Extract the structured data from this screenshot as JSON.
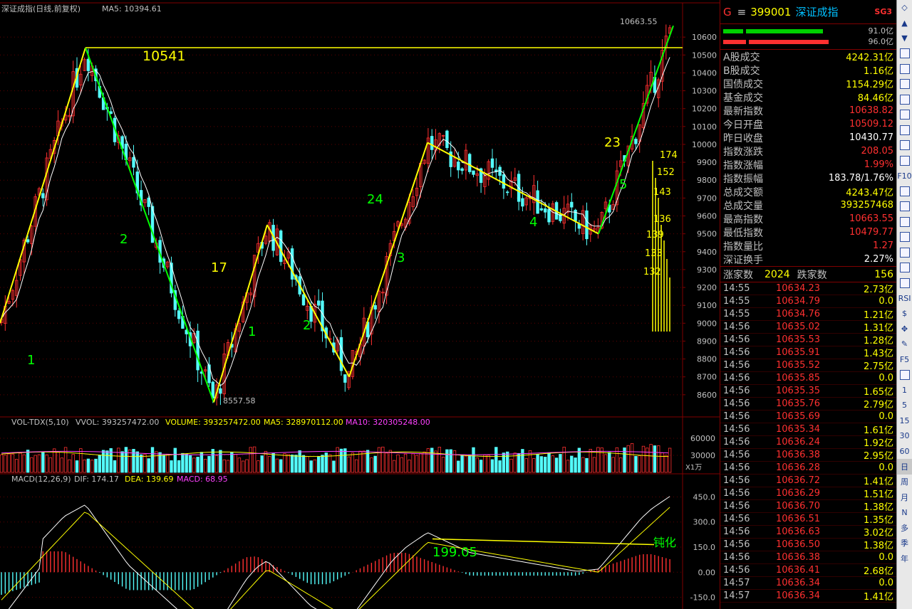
{
  "main_chart": {
    "title": "深证成指(日线,前复权)",
    "ma_label": "MA5: 10394.61",
    "high_label": "10663.55",
    "low_label": "8557.58",
    "y_ticks": [
      "10600",
      "10500",
      "10400",
      "10300",
      "10200",
      "10100",
      "10000",
      "9900",
      "9800",
      "9700",
      "9600",
      "9500",
      "9400",
      "9300",
      "9200",
      "9100",
      "9000",
      "8900",
      "8800",
      "8700",
      "8600"
    ],
    "annotations": {
      "peak": "10541",
      "w1": "1",
      "w2": "2",
      "w17": "17",
      "w1b": "1",
      "w2b": "2",
      "w24": "24",
      "w3": "3",
      "w4": "4",
      "w23": "23",
      "w5": "5",
      "stack": [
        "174",
        "152",
        "143",
        "136",
        "139",
        "133",
        "132"
      ]
    }
  },
  "vol_panel": {
    "label": "VOL-TDX(5,10)",
    "vvol": "VVOL: 393257472.00",
    "volume": "VOLUME: 393257472.00",
    "ma5": "MA5: 328970112.00",
    "ma10": "MA10: 320305248.00",
    "y_ticks": [
      "60000",
      "30000"
    ],
    "unit": "X1万"
  },
  "macd_panel": {
    "label": "MACD(12,26,9)",
    "dif": "DIF: 174.17",
    "dea": "DEA: 139.69",
    "macd": "MACD: 68.95",
    "y_ticks": [
      "450.0",
      "300.0",
      "150.0",
      "0.00",
      "-150.0"
    ],
    "note_value": "199.05",
    "note_text": "钝化"
  },
  "chart_data": {
    "type": "candlestick",
    "title": "深证成指(日线,前复权)",
    "ylim": [
      8480,
      10720
    ],
    "price_path": [
      [
        0,
        9000
      ],
      [
        120,
        10541
      ],
      [
        300,
        8557.58
      ],
      [
        375,
        9550
      ],
      [
        490,
        8700
      ],
      [
        600,
        10010
      ],
      [
        840,
        9500
      ],
      [
        945,
        10663.55
      ]
    ],
    "swing_points": [
      {
        "x": 0,
        "y": 9000
      },
      {
        "x": 120,
        "y": 10541
      },
      {
        "x": 300,
        "y": 8557.58
      },
      {
        "x": 375,
        "y": 9550
      },
      {
        "x": 490,
        "y": 8700
      },
      {
        "x": 600,
        "y": 10010
      },
      {
        "x": 840,
        "y": 9500
      },
      {
        "x": 945,
        "y": 10663.55
      }
    ],
    "vol_ylim": [
      0,
      75000
    ],
    "macd_ylim": [
      -220,
      520
    ]
  },
  "right_panel": {
    "header": {
      "badge": "G",
      "menu": "≡",
      "code": "399001",
      "name": "深证成指",
      "tag": "SG3"
    },
    "bars": {
      "top_value": "91.0亿",
      "bottom_value": "96.0亿"
    },
    "stats": [
      {
        "label": "A股成交",
        "value": "4242.31亿",
        "color": "c-y"
      },
      {
        "label": "B股成交",
        "value": "1.16亿",
        "color": "c-y"
      },
      {
        "label": "国债成交",
        "value": "1154.29亿",
        "color": "c-y"
      },
      {
        "label": "基金成交",
        "value": "84.46亿",
        "color": "c-y"
      },
      {
        "label": "最新指数",
        "value": "10638.82",
        "color": "c-r"
      },
      {
        "label": "今日开盘",
        "value": "10509.12",
        "color": "c-r"
      },
      {
        "label": "昨日收盘",
        "value": "10430.77",
        "color": "c-w"
      },
      {
        "label": "指数涨跌",
        "value": "208.05",
        "color": "c-r"
      },
      {
        "label": "指数涨幅",
        "value": "1.99%",
        "color": "c-r"
      },
      {
        "label": "指数振幅",
        "value": "183.78/1.76%",
        "color": "c-w"
      },
      {
        "label": "总成交额",
        "value": "4243.47亿",
        "color": "c-y"
      },
      {
        "label": "总成交量",
        "value": "393257468",
        "color": "c-y"
      },
      {
        "label": "最高指数",
        "value": "10663.55",
        "color": "c-r"
      },
      {
        "label": "最低指数",
        "value": "10479.77",
        "color": "c-r"
      },
      {
        "label": "指数量比",
        "value": "1.27",
        "color": "c-r"
      },
      {
        "label": "深证换手",
        "value": "2.27%",
        "color": "c-w"
      }
    ],
    "updown": {
      "up_label": "涨家数",
      "up_value": "2024",
      "down_label": "跌家数",
      "down_value": "156"
    },
    "ticks": [
      {
        "time": "14:55",
        "price": "10634.23",
        "vol": "2.73亿"
      },
      {
        "time": "14:55",
        "price": "10634.79",
        "vol": "0.0"
      },
      {
        "time": "14:55",
        "price": "10634.76",
        "vol": "1.21亿"
      },
      {
        "time": "14:56",
        "price": "10635.02",
        "vol": "1.31亿"
      },
      {
        "time": "14:56",
        "price": "10635.53",
        "vol": "1.28亿"
      },
      {
        "time": "14:56",
        "price": "10635.91",
        "vol": "1.43亿"
      },
      {
        "time": "14:56",
        "price": "10635.52",
        "vol": "2.75亿"
      },
      {
        "time": "14:56",
        "price": "10635.85",
        "vol": "0.0"
      },
      {
        "time": "14:56",
        "price": "10635.35",
        "vol": "1.65亿"
      },
      {
        "time": "14:56",
        "price": "10635.76",
        "vol": "2.79亿"
      },
      {
        "time": "14:56",
        "price": "10635.69",
        "vol": "0.0"
      },
      {
        "time": "14:56",
        "price": "10635.34",
        "vol": "1.61亿"
      },
      {
        "time": "14:56",
        "price": "10636.24",
        "vol": "1.92亿"
      },
      {
        "time": "14:56",
        "price": "10636.38",
        "vol": "2.95亿"
      },
      {
        "time": "14:56",
        "price": "10636.28",
        "vol": "0.0"
      },
      {
        "time": "14:56",
        "price": "10636.72",
        "vol": "1.41亿"
      },
      {
        "time": "14:56",
        "price": "10636.29",
        "vol": "1.51亿"
      },
      {
        "time": "14:56",
        "price": "10636.70",
        "vol": "1.38亿"
      },
      {
        "time": "14:56",
        "price": "10636.51",
        "vol": "1.35亿"
      },
      {
        "time": "14:56",
        "price": "10636.63",
        "vol": "3.02亿"
      },
      {
        "time": "14:56",
        "price": "10636.50",
        "vol": "1.38亿"
      },
      {
        "time": "14:56",
        "price": "10636.38",
        "vol": "0.0"
      },
      {
        "time": "14:56",
        "price": "10636.41",
        "vol": "2.68亿"
      },
      {
        "time": "14:57",
        "price": "10636.34",
        "vol": "0.0"
      },
      {
        "time": "14:57",
        "price": "10636.34",
        "vol": "1.41亿"
      }
    ]
  },
  "toolbar": {
    "buttons": [
      "◇",
      "▲",
      "▼",
      "",
      "",
      "",
      "",
      "",
      "",
      "",
      "",
      "F10",
      "",
      "",
      "",
      "",
      "",
      "",
      "",
      "RSI",
      "$",
      "✥",
      "✎",
      "F5",
      "",
      "1",
      "5",
      "15",
      "30",
      "60",
      "日",
      "周",
      "月",
      "N",
      "多",
      "季",
      "年"
    ]
  }
}
